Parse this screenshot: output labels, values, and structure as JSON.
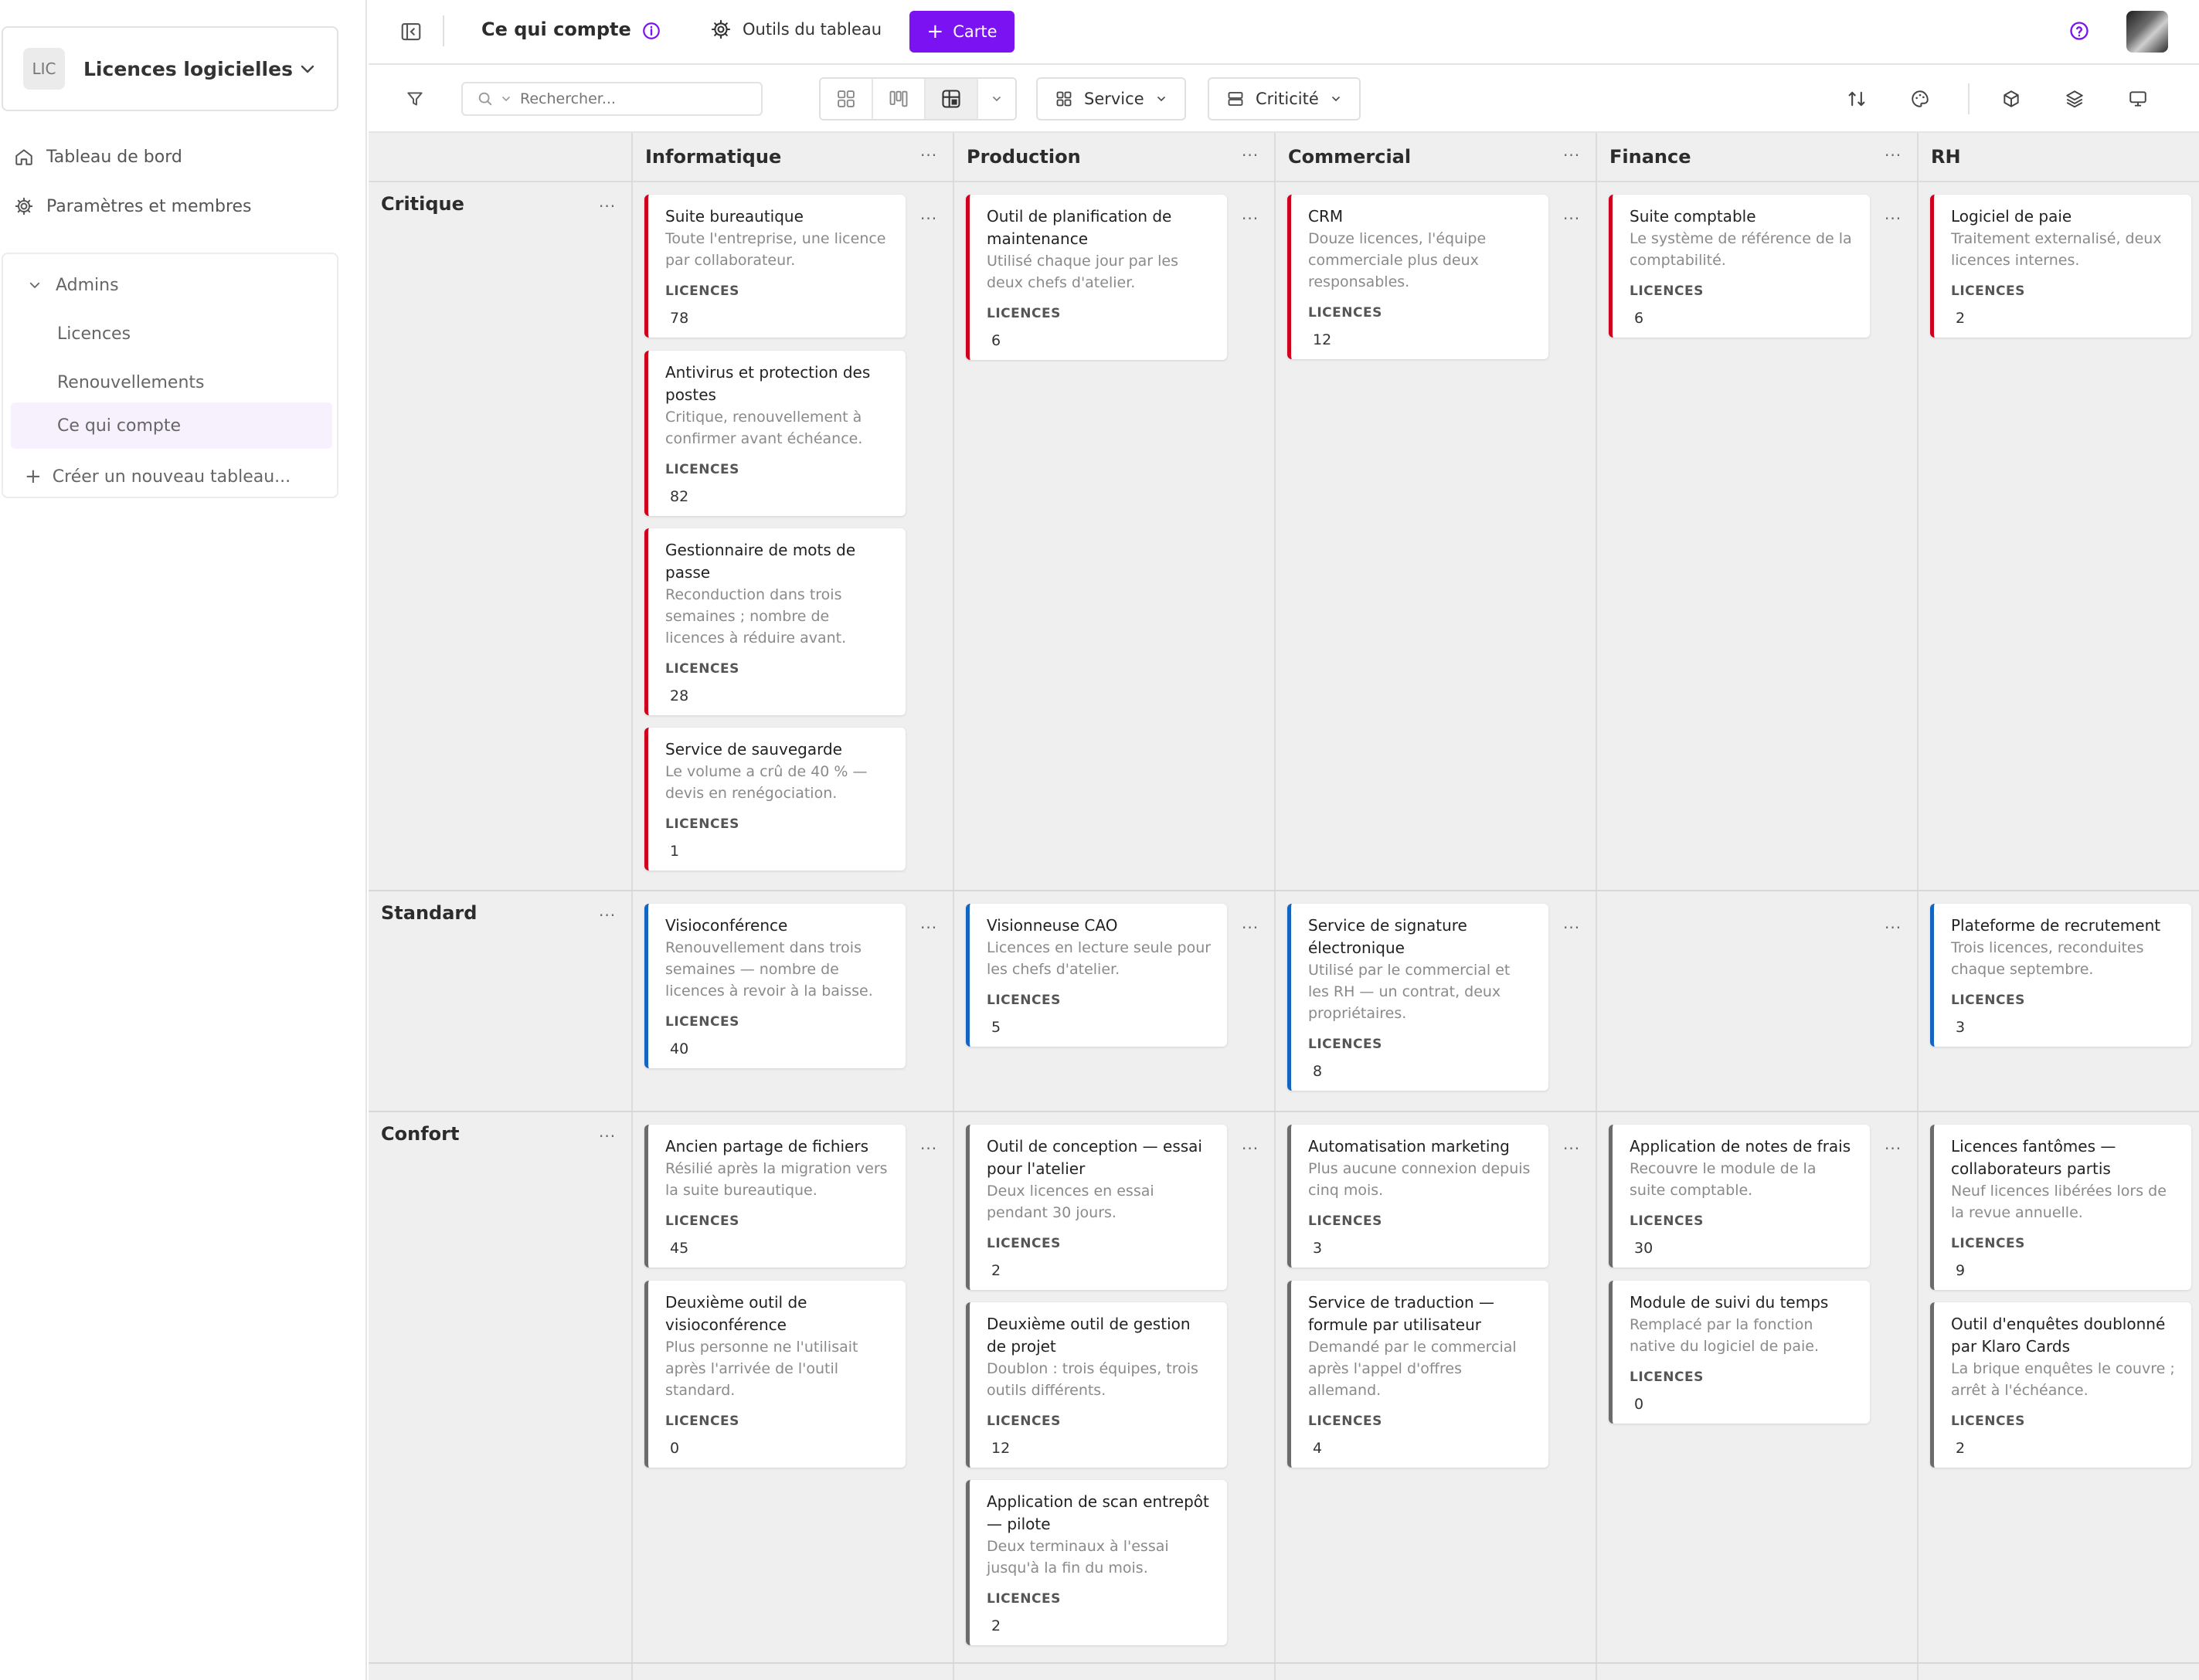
{
  "sidebar": {
    "workspace_badge": "LIC",
    "workspace_name": "Licences logicielles &...",
    "nav": [
      "Tableau de bord",
      "Paramètres et membres"
    ],
    "group_name": "Admins",
    "boards": [
      "Licences",
      "Renouvellements",
      "Ce qui compte"
    ],
    "active_board": "Ce qui compte",
    "create_board": "Créer un nouveau tableau..."
  },
  "topbar": {
    "board_title": "Ce qui compte",
    "tools_label": "Outils du tableau",
    "new_card_label": "Carte"
  },
  "toolbar": {
    "search_placeholder": "Rechercher...",
    "group_by": "Service",
    "sub_group_by": "Criticité"
  },
  "board": {
    "columns": [
      "Informatique",
      "Production",
      "Commercial",
      "Finance",
      "RH"
    ],
    "rows": [
      "Critique",
      "Standard",
      "Confort"
    ],
    "field_label": "LICENCES",
    "colors": {
      "critique": "#d0021b",
      "standard": "#1565c0",
      "confort": "#6b6b6b",
      "accent": "#7a12f2"
    }
  },
  "cards": {
    "c0_i0": {
      "title": "Suite bureautique",
      "desc": "Toute l'entreprise, une licence par collaborateur.",
      "value": "78"
    },
    "c0_i1": {
      "title": "Antivirus et protection des postes",
      "desc": "Critique, renouvellement à confirmer avant échéance.",
      "value": "82"
    },
    "c0_i2": {
      "title": "Gestionnaire de mots de passe",
      "desc": "Reconduction dans trois semaines ; nombre de licences à réduire avant.",
      "value": "28"
    },
    "c0_i3": {
      "title": "Service de sauvegarde",
      "desc": "Le volume a crû de 40 % — devis en renégociation.",
      "value": "1"
    },
    "c0_p0": {
      "title": "Outil de planification de maintenance",
      "desc": "Utilisé chaque jour par les deux chefs d'atelier.",
      "value": "6"
    },
    "c0_c0": {
      "title": "CRM",
      "desc": "Douze licences, l'équipe commerciale plus deux responsables.",
      "value": "12"
    },
    "c0_f0": {
      "title": "Suite comptable",
      "desc": "Le système de référence de la comptabilité.",
      "value": "6"
    },
    "c0_r0": {
      "title": "Logiciel de paie",
      "desc": "Traitement externalisé, deux licences internes.",
      "value": "2"
    },
    "c1_i0": {
      "title": "Visioconférence",
      "desc": "Renouvellement dans trois semaines — nombre de licences à revoir à la baisse.",
      "value": "40"
    },
    "c1_p0": {
      "title": "Visionneuse CAO",
      "desc": "Licences en lecture seule pour les chefs d'atelier.",
      "value": "5"
    },
    "c1_c0": {
      "title": "Service de signature électronique",
      "desc": "Utilisé par le commercial et les RH — un contrat, deux propriétaires.",
      "value": "8"
    },
    "c1_r0": {
      "title": "Plateforme de recrutement",
      "desc": "Trois licences, reconduites chaque septembre.",
      "value": "3"
    },
    "c2_i0": {
      "title": "Ancien partage de fichiers",
      "desc": "Résilié après la migration vers la suite bureautique.",
      "value": "45"
    },
    "c2_i1": {
      "title": "Deuxième outil de visioconférence",
      "desc": "Plus personne ne l'utilisait après l'arrivée de l'outil standard.",
      "value": "0"
    },
    "c2_p0": {
      "title": "Outil de conception — essai pour l'atelier",
      "desc": "Deux licences en essai pendant 30 jours.",
      "value": "2"
    },
    "c2_p1": {
      "title": "Deuxième outil de gestion de projet",
      "desc": "Doublon : trois équipes, trois outils différents.",
      "value": "12"
    },
    "c2_p2": {
      "title": "Application de scan entrepôt — pilote",
      "desc": "Deux terminaux à l'essai jusqu'à la fin du mois.",
      "value": "2"
    },
    "c2_c0": {
      "title": "Automatisation marketing",
      "desc": "Plus aucune connexion depuis cinq mois.",
      "value": "3"
    },
    "c2_c1": {
      "title": "Service de traduction — formule par utilisateur",
      "desc": "Demandé par le commercial après l'appel d'offres allemand.",
      "value": "4"
    },
    "c2_f0": {
      "title": "Application de notes de frais",
      "desc": "Recouvre le module de la suite comptable.",
      "value": "30"
    },
    "c2_f1": {
      "title": "Module de suivi du temps",
      "desc": "Remplacé par la fonction native du logiciel de paie.",
      "value": "0"
    },
    "c2_r0": {
      "title": "Licences fantômes — collaborateurs partis",
      "desc": "Neuf licences libérées lors de la revue annuelle.",
      "value": "9"
    },
    "c2_r1": {
      "title": "Outil d'enquêtes doublonné par Klaro Cards",
      "desc": "La brique enquêtes le couvre ; arrêt à l'échéance.",
      "value": "2"
    }
  }
}
